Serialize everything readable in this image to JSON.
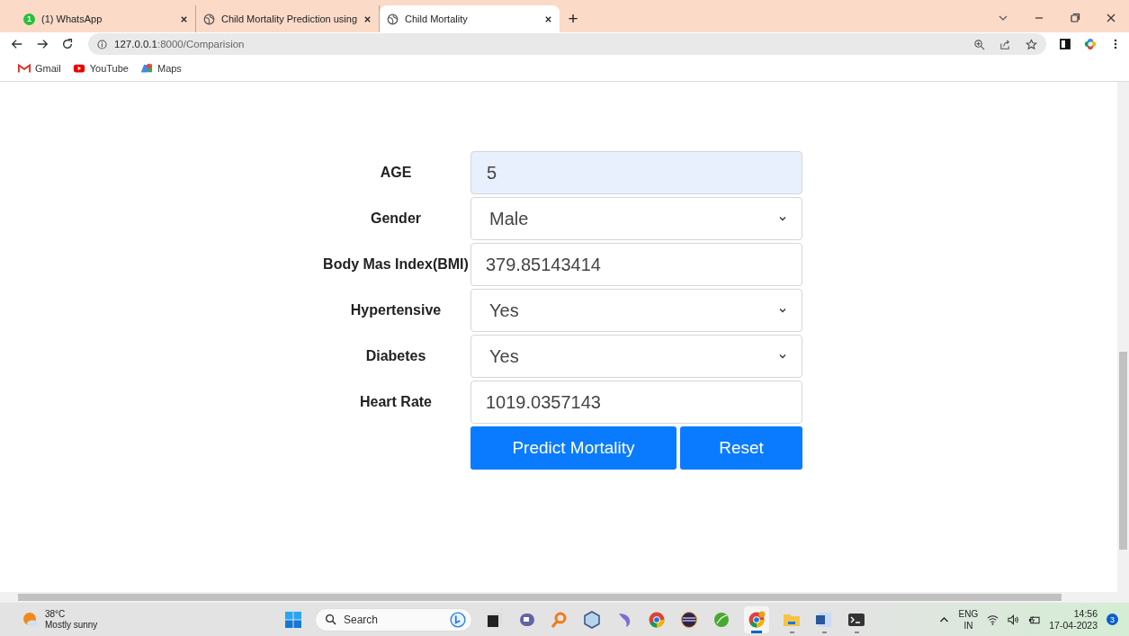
{
  "tabs": [
    {
      "kind": "whatsapp",
      "badge": "1",
      "title": "(1) WhatsApp",
      "selected": false
    },
    {
      "kind": "globe",
      "title": "Child Mortality Prediction using",
      "selected": false
    },
    {
      "kind": "globe",
      "title": "Child Mortality",
      "selected": true
    }
  ],
  "new_tab": "+",
  "address": {
    "host": "127.0.0.1",
    "path": ":8000/Comparision"
  },
  "bookmarks": [
    {
      "kind": "gmail",
      "label": "Gmail"
    },
    {
      "kind": "youtube",
      "label": "YouTube"
    },
    {
      "kind": "maps",
      "label": "Maps"
    }
  ],
  "form": {
    "fields": [
      {
        "label": "AGE",
        "kind": "text",
        "value": "5",
        "autofilled": true
      },
      {
        "label": "Gender",
        "kind": "select",
        "value": "Male",
        "autofilled": false
      },
      {
        "label": "Body Mas Index(BMI)",
        "kind": "text",
        "value": "379.85143414",
        "autofilled": false
      },
      {
        "label": "Hypertensive",
        "kind": "select",
        "value": "Yes",
        "autofilled": false
      },
      {
        "label": "Diabetes",
        "kind": "select",
        "value": "Yes",
        "autofilled": false
      },
      {
        "label": "Heart Rate",
        "kind": "text",
        "value": "1019.0357143",
        "autofilled": false
      }
    ],
    "buttons": [
      "Predict Mortality",
      "Reset"
    ]
  },
  "taskbar": {
    "weather": {
      "temperature": "38°C",
      "condition": "Mostly sunny"
    },
    "search": {
      "placeholder": "Search"
    },
    "apps": [
      {
        "kind": "taskview",
        "running": false,
        "active": false
      },
      {
        "kind": "chat",
        "running": false,
        "active": false
      },
      {
        "kind": "magnifier",
        "running": false,
        "active": false
      },
      {
        "kind": "cube",
        "running": false,
        "active": false
      },
      {
        "kind": "dolphin",
        "running": false,
        "active": false
      },
      {
        "kind": "chrome",
        "running": false,
        "active": false
      },
      {
        "kind": "eclipse",
        "running": false,
        "active": false
      },
      {
        "kind": "leaf",
        "running": false,
        "active": false
      },
      {
        "kind": "canary",
        "running": true,
        "active": true
      },
      {
        "kind": "folder",
        "running": true,
        "active": false
      },
      {
        "kind": "word",
        "running": true,
        "active": false
      },
      {
        "kind": "terminal",
        "running": true,
        "active": false
      }
    ],
    "language": "ENG",
    "region": "IN",
    "time": "14:56",
    "date": "17-04-2023",
    "notifications": "3"
  }
}
